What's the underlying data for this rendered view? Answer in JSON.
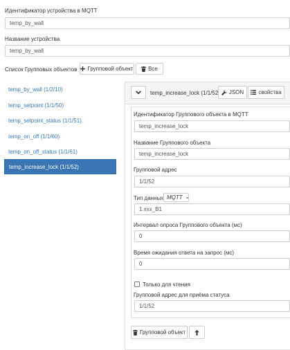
{
  "device": {
    "mqtt_id_label": "Идентификатор устройства в MQTT",
    "mqtt_id_value": "temp_by_wall",
    "name_label": "Название устройства",
    "name_value": "temp_by_wall"
  },
  "group_objects": {
    "list_label": "Список Групповых объектов",
    "add_button": "Групповой объект",
    "all_button": "Все",
    "items": [
      {
        "label": "temp_by_wall (1/2/10)"
      },
      {
        "label": "temp_setpoint (1/1/50)"
      },
      {
        "label": "temp_setpoint_status (1/1/51)"
      },
      {
        "label": "temp_on_off (1/1/60)"
      },
      {
        "label": "temp_on_off_status (1/1/61)"
      },
      {
        "label": "temp_increase_lock (1/1/52)"
      }
    ],
    "selected_index": 5
  },
  "detail": {
    "title": "temp_increase_lock (1/1/52)",
    "json_button": "JSON",
    "props_button": "свойства",
    "mqtt_id_label": "Идентификатор Группового объекта в MQTT",
    "mqtt_id_value": "temp_increase_lock",
    "name_label": "Название Группового объекта",
    "name_value": "temp_increase_lock",
    "group_address_label": "Групповой адрес",
    "group_address_value": "1/1/52",
    "data_type_label": "Тип данных",
    "data_type_selected": "MQTT",
    "data_type_value": "1.xxx_B1",
    "poll_interval_label": "Интервал опроса Группового объекта (мс)",
    "poll_interval_value": "0",
    "response_timeout_label": "Время ожидания ответа на запрос (мс)",
    "response_timeout_value": "0",
    "read_only_label": "Только для чтения",
    "read_only_checked": false,
    "status_address_label": "Групповой адрес для приёма статуса",
    "status_address_value": "1/1/52",
    "delete_button": "Групповой объект"
  }
}
